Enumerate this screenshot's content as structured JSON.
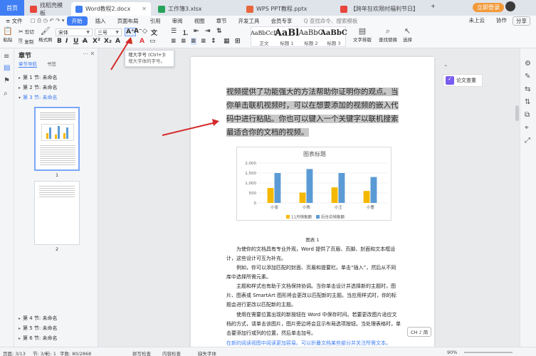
{
  "titlebar": {
    "home": "首页",
    "tabs": [
      {
        "label": "找稻壳模板",
        "icon_color": "#e8453c"
      },
      {
        "label": "Word教程2.docx",
        "icon_color": "#3f7ef4"
      },
      {
        "label": "工作簿3.xlsx",
        "icon_color": "#26a35b"
      },
      {
        "label": "WPS PPT教程.pptx",
        "icon_color": "#e8663c"
      },
      {
        "label": "【跨年狂欢限时福利节日】",
        "icon_color": "#e8453c"
      }
    ],
    "login_label": "立即登录",
    "plus": "+"
  },
  "menubar": {
    "file": "≡ 文件",
    "items": [
      "开始",
      "插入",
      "页面布局",
      "引用",
      "审阅",
      "视图",
      "章节",
      "开发工具",
      "会员专享"
    ],
    "search_placeholder": "Q 查找命令、搜索模板",
    "right": [
      "未上云",
      "协作",
      "分享"
    ]
  },
  "ribbon": {
    "paste": "粘贴",
    "cut": "剪切",
    "copy": "复制",
    "format_painter": "格式刷",
    "font_name": "宋体",
    "font_size": "三号",
    "styles": [
      {
        "sample": "AaBbCcD",
        "label": "正文"
      },
      {
        "sample": "AaBl",
        "label": "标题 1"
      },
      {
        "sample": "AaBbC",
        "label": "标题 2"
      },
      {
        "sample": "AaBbC",
        "label": "标题 3"
      }
    ],
    "text_layout": "文字排版",
    "find_replace": "查找替换",
    "select": "选择"
  },
  "tooltip": {
    "title": "增大字号 (Ctrl+])",
    "desc": "增大字体的字号。"
  },
  "nav": {
    "title": "章节",
    "tabs": [
      "章节导航",
      "书签"
    ],
    "sections_top": [
      "第 1 节: 未命名",
      "第 2 节: 未命名",
      "第 3 节: 未命名"
    ],
    "page_numbers": [
      "1",
      "2"
    ],
    "sections_bottom": [
      "第 4 节: 未命名",
      "第 5 节: 未命名",
      "第 6 节: 未命名"
    ]
  },
  "doc": {
    "highlighted": "视频提供了功能强大的方法帮助你证明你的观点。当你单击联机视频时，可以在想要添加的视频的嵌入代码中进行粘贴。你也可以键入一个关键字以联机搜索最适合你的文档的视频。",
    "figure_caption": "图表 1",
    "paragraphs": [
      "为使你的文档具有专业外观，Word 提供了页眉、页脚、封面和文本框设计，这些设计可互为补充。",
      "例如，你可以添加匹配的封面、页眉和提要栏。单击“插入”，然后从不同库中选择所需元素。",
      "主题和样式也有助于文档保持协调。当你单击设计并选择新的主题时，图片、图表或 SmartArt 图形将会更改以匹配新的主题。当应用样式时，你的标题会进行更改以匹配新的主题。",
      "使用在需要位置出现的新按钮在 Word 中保存时间。若要更改图片适应文档的方式，请单击该图片，图片旁边将会显示布局选项按钮。当处理表格时，单击要添加行或列的位置，然后单击加号。"
    ],
    "footer_hint": "在新的阅读视图中阅读更加容易。可以折叠文档某些部分并关注所需文本。",
    "lang_badge": "CH ♪ 简"
  },
  "side_panel": {
    "label": "论文查重"
  },
  "chart_data": {
    "type": "bar",
    "title": "图表标题",
    "categories": [
      "小张",
      "小陈",
      "小王",
      "小曹"
    ],
    "series": [
      {
        "name": "11月销售额",
        "color": "#f5b800",
        "values": [
          750,
          520,
          780,
          600
        ]
      },
      {
        "name": "后台总销售额",
        "color": "#5b9bd5",
        "values": [
          1500,
          1700,
          1500,
          1300
        ]
      }
    ],
    "yticks": [
      "0",
      "500",
      "1,000",
      "1,500",
      "2,000"
    ],
    "ylim": [
      0,
      2000
    ],
    "grid": true,
    "legend": "bottom"
  },
  "statusbar": {
    "page": "页面: 3/13",
    "section": "节: 3/6",
    "line": "行: 1",
    "words": "字数: 80/2868",
    "spell": "拼写检查",
    "content_check": "内容检查",
    "missing_font": "缺失字体",
    "zoom": "90%"
  }
}
